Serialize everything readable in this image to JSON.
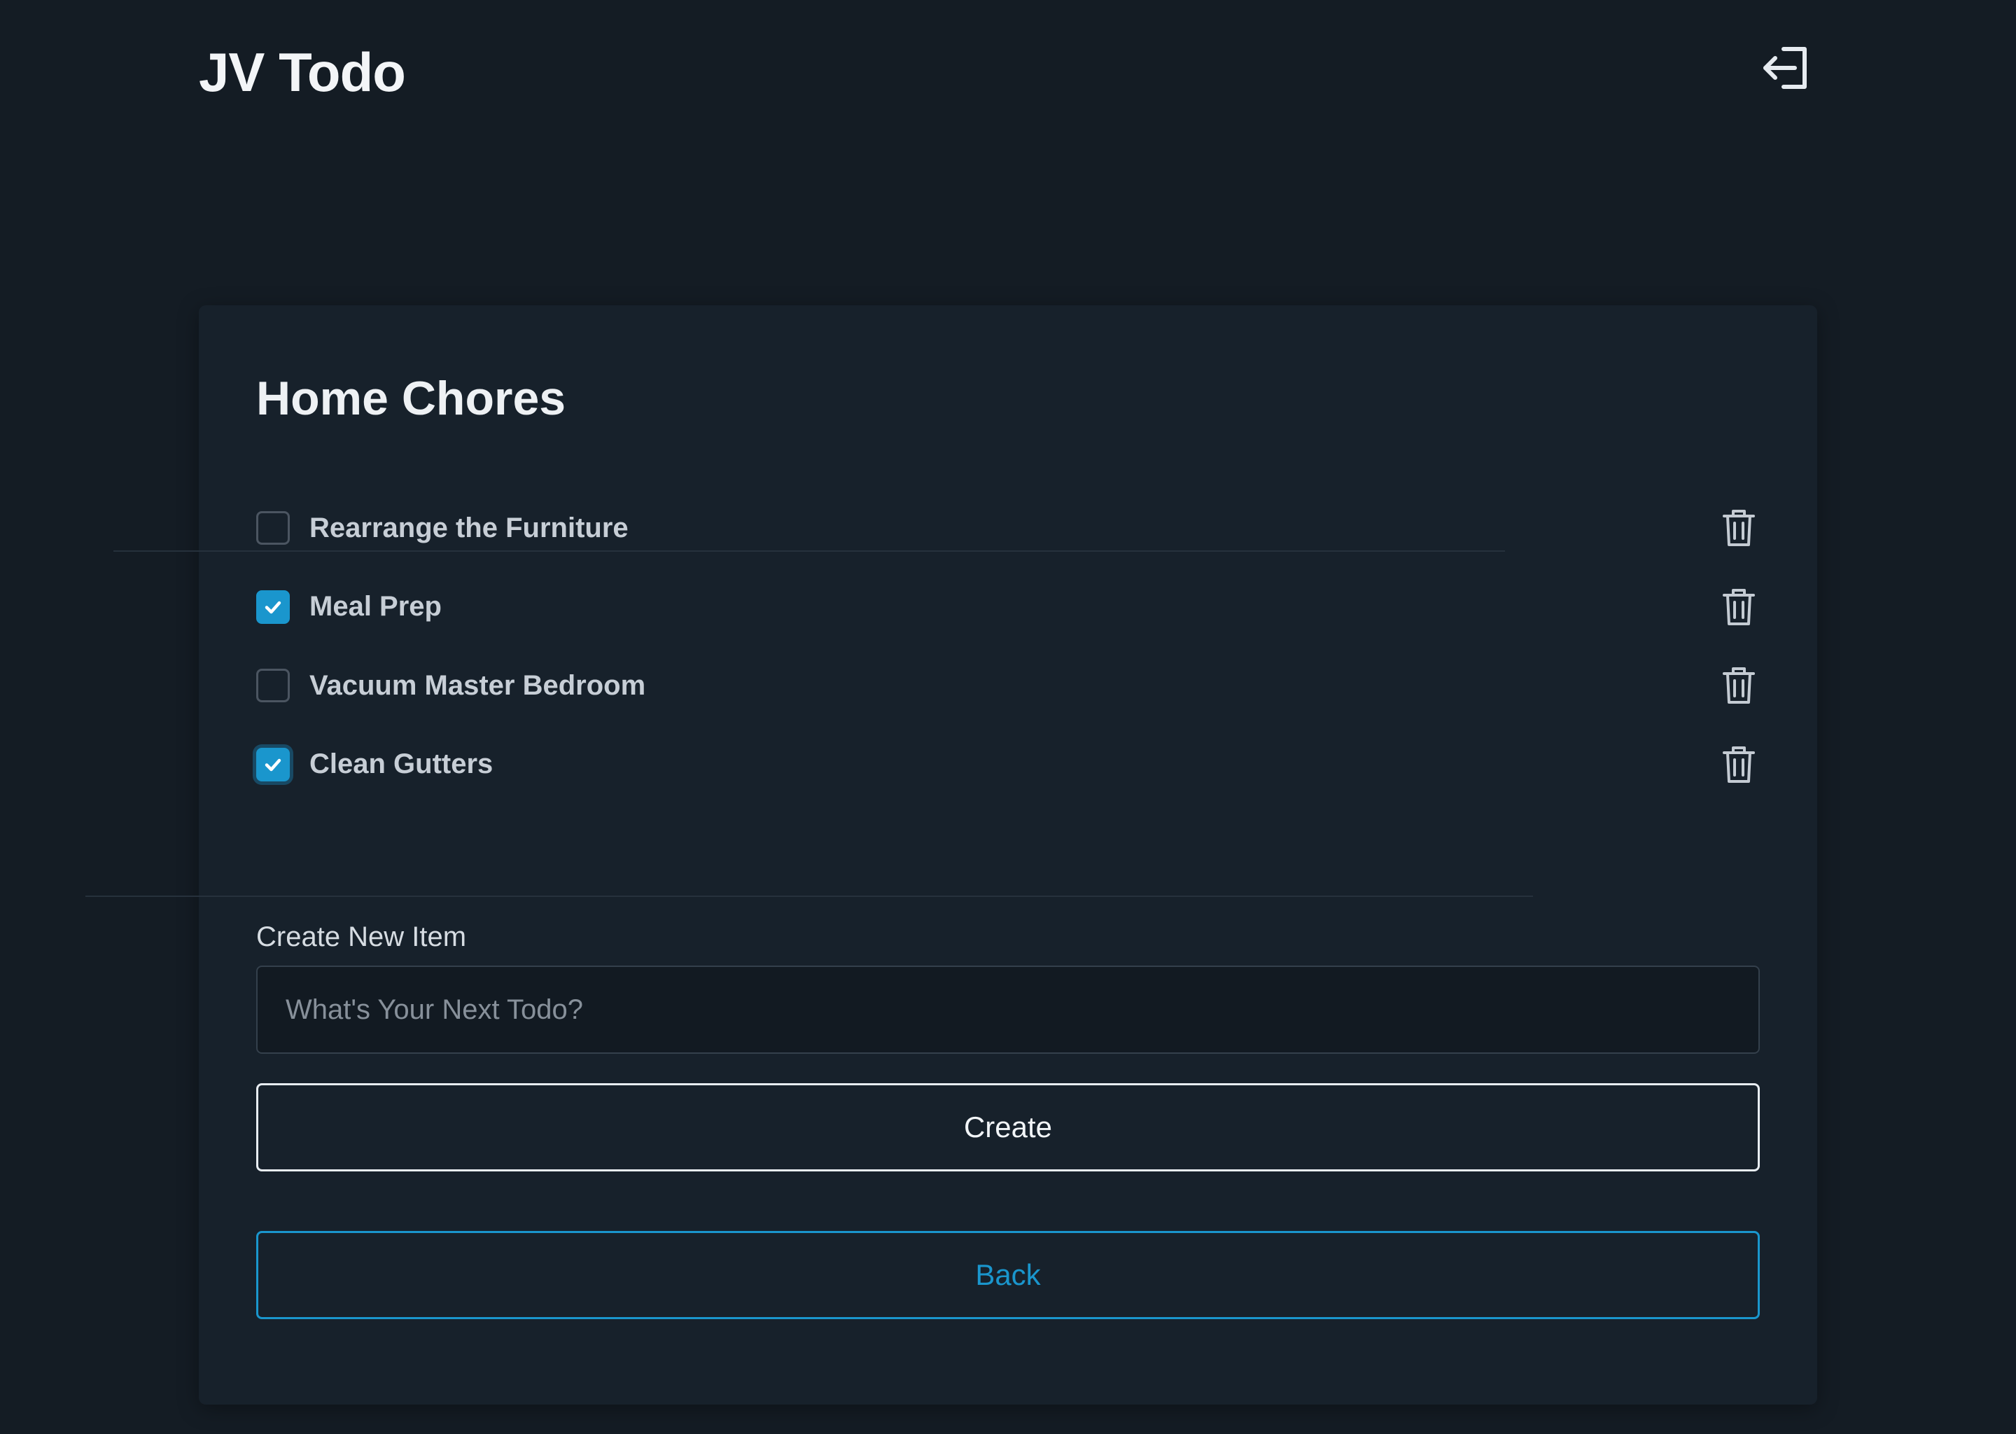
{
  "header": {
    "app_title": "JV Todo",
    "logout_icon": "logout-icon"
  },
  "list": {
    "title": "Home Chores",
    "items": [
      {
        "label": "Rearrange the Furniture",
        "checked": false
      },
      {
        "label": "Meal Prep",
        "checked": true
      },
      {
        "label": "Vacuum Master Bedroom",
        "checked": false
      },
      {
        "label": "Clean Gutters",
        "checked": true
      }
    ]
  },
  "create_form": {
    "label": "Create New Item",
    "input_value": "",
    "input_placeholder": "What's Your Next Todo?",
    "create_label": "Create"
  },
  "back_label": "Back",
  "colors": {
    "background": "#141c24",
    "card": "#17212b",
    "accent": "#1a96cd"
  }
}
